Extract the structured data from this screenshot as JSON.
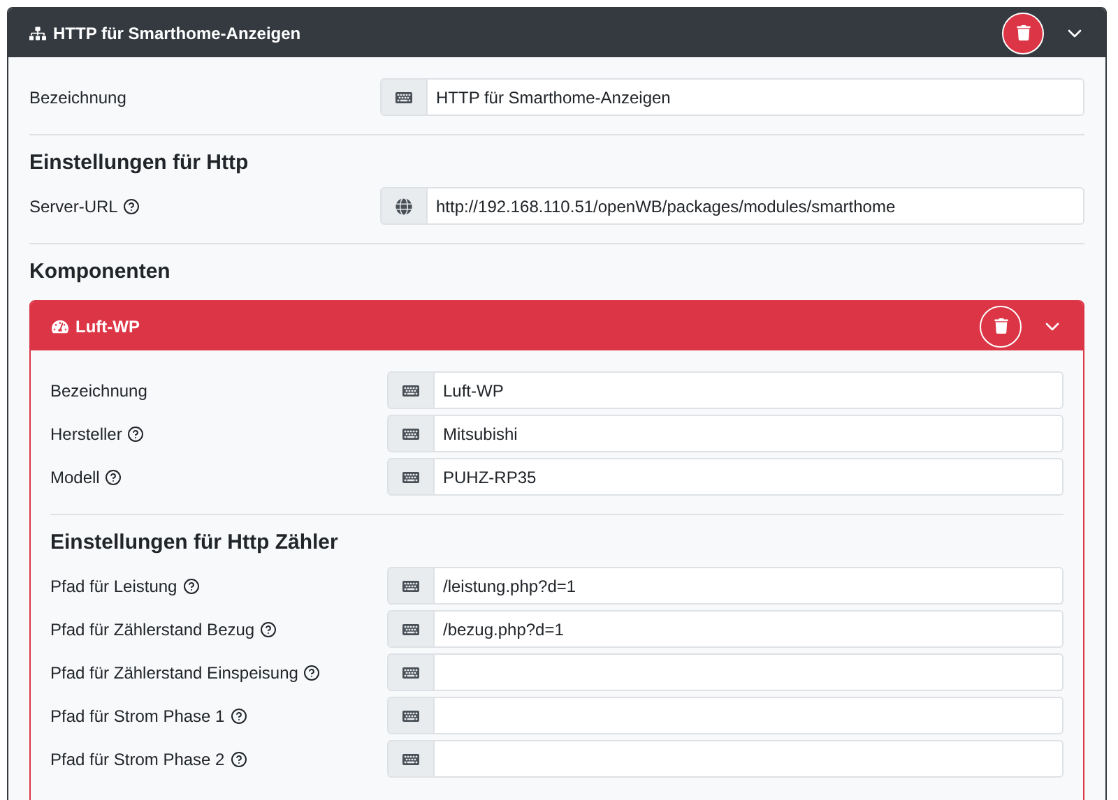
{
  "device": {
    "title": "HTTP für Smarthome-Anzeigen",
    "fields": [
      {
        "label": "Bezeichnung",
        "help": false,
        "kind": "text",
        "value": "HTTP für Smarthome-Anzeigen"
      }
    ],
    "settings_heading": "Einstellungen für Http",
    "settings_fields": [
      {
        "label": "Server-URL",
        "help": true,
        "kind": "url",
        "value": "http://192.168.110.51/openWB/packages/modules/smarthome"
      }
    ],
    "components_heading": "Komponenten",
    "components": [
      {
        "title": "Luft-WP",
        "fields": [
          {
            "label": "Bezeichnung",
            "help": false,
            "kind": "text",
            "value": "Luft-WP"
          },
          {
            "label": "Hersteller",
            "help": true,
            "kind": "text",
            "value": "Mitsubishi"
          },
          {
            "label": "Modell",
            "help": true,
            "kind": "text",
            "value": "PUHZ-RP35"
          }
        ],
        "settings_heading": "Einstellungen für Http Zähler",
        "settings_fields": [
          {
            "label": "Pfad für Leistung",
            "help": true,
            "kind": "text",
            "value": "/leistung.php?d=1"
          },
          {
            "label": "Pfad für Zählerstand Bezug",
            "help": true,
            "kind": "text",
            "value": "/bezug.php?d=1"
          },
          {
            "label": "Pfad für Zählerstand Einspeisung",
            "help": true,
            "kind": "text"
          },
          {
            "label": "Pfad für Strom Phase 1",
            "help": true,
            "kind": "text"
          },
          {
            "label": "Pfad für Strom Phase 2",
            "help": true,
            "kind": "text"
          }
        ]
      }
    ]
  }
}
